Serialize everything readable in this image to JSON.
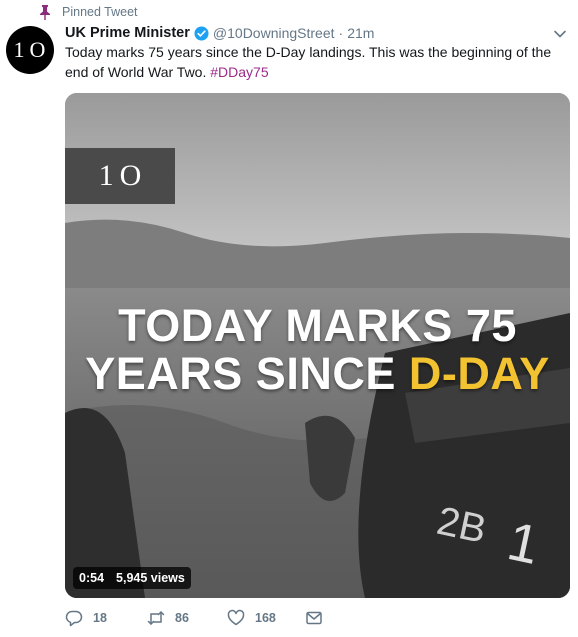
{
  "pinned": {
    "label": "Pinned Tweet",
    "icon": "pin-icon",
    "color": "#8b2c7e"
  },
  "avatar": {
    "text": "1O"
  },
  "tweet": {
    "author_name": "UK Prime Minister",
    "verified": true,
    "handle": "@10DowningStreet",
    "separator": "·",
    "time": "21m",
    "text": "Today marks 75 years since the D-Day landings. This was the beginning of the end of World War Two. ",
    "hashtag": "#DDay75"
  },
  "media": {
    "brand_mark": "1O",
    "headline_line1": "TODAY MARKS 75",
    "headline_line2_white": "YEARS SINCE ",
    "headline_line2_yellow": "D-DAY",
    "highlight_color": "#f2c230",
    "duration": "0:54",
    "views": "5,945 views"
  },
  "actions": {
    "replies": "18",
    "retweets": "86",
    "likes": "168"
  },
  "colors": {
    "accent": "#1da1f2",
    "hashtag": "#9b2c8a",
    "muted": "#657786"
  }
}
